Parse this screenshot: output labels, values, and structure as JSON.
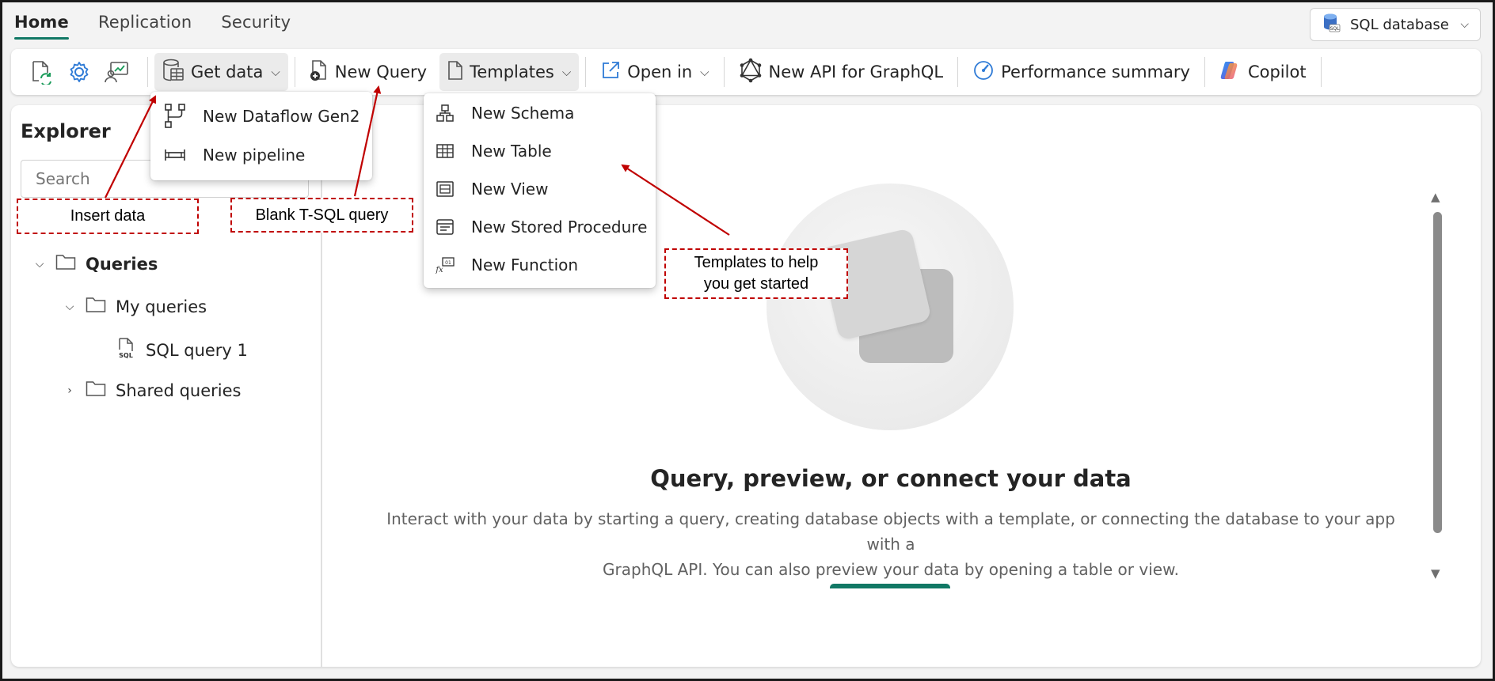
{
  "tabs": [
    "Home",
    "Replication",
    "Security"
  ],
  "db_button": {
    "label": "SQL database",
    "icon": "sql-database-icon"
  },
  "ribbon": {
    "icon_buttons": [
      "refresh-icon",
      "settings-icon",
      "share-icon"
    ],
    "get_data": "Get data",
    "new_query": "New Query",
    "templates": "Templates",
    "open_in": "Open in",
    "new_api": "New API for GraphQL",
    "performance": "Performance summary",
    "copilot": "Copilot"
  },
  "get_data_menu": [
    {
      "label": "New Dataflow Gen2",
      "icon": "dataflow-icon"
    },
    {
      "label": "New pipeline",
      "icon": "pipeline-icon"
    }
  ],
  "templates_menu": [
    {
      "label": "New Schema",
      "icon": "schema-icon"
    },
    {
      "label": "New Table",
      "icon": "table-icon"
    },
    {
      "label": "New View",
      "icon": "view-icon"
    },
    {
      "label": "New Stored Procedure",
      "icon": "stored-procedure-icon"
    },
    {
      "label": "New Function",
      "icon": "function-icon"
    }
  ],
  "explorer": {
    "title": "Explorer",
    "search_placeholder": "Search",
    "tree": {
      "root": "Queries",
      "my_queries": "My queries",
      "query_item": "SQL query 1",
      "shared_queries": "Shared queries"
    }
  },
  "empty_state": {
    "title": "Query, preview, or connect your data",
    "description_line1": "Interact with your data by starting a query, creating database objects with a template, or connecting the database to your app with a",
    "description_line2": "GraphQL API. You can also preview your data by opening a table or view."
  },
  "annotations": {
    "insert_data": "Insert data",
    "blank_query": "Blank T-SQL query",
    "templates_line1": "Templates to help",
    "templates_line2": "you get started"
  },
  "colors": {
    "accent": "#117865",
    "annotation": "#c00000"
  }
}
